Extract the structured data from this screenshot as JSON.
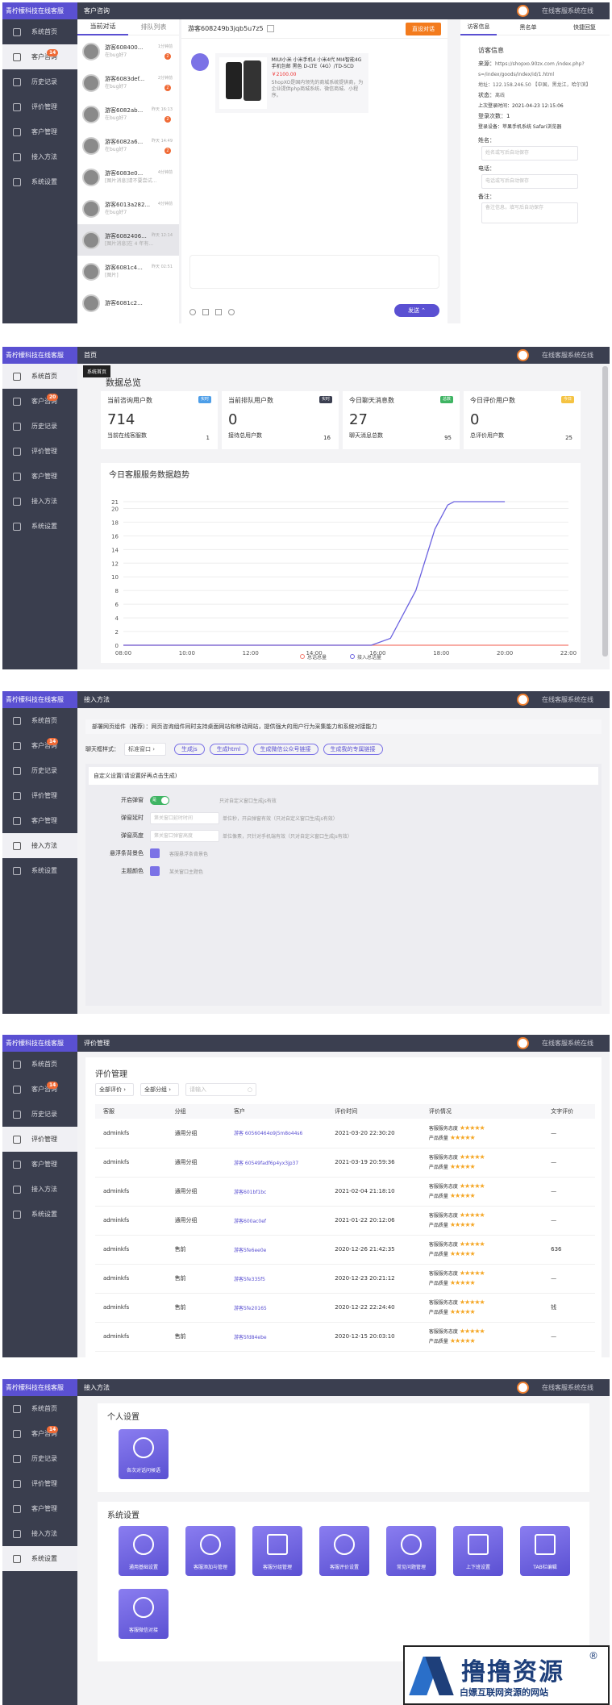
{
  "brand": "青柠檬科技在线客服",
  "online_text": "在线客服系统在线",
  "nav": [
    "系统首页",
    "客户咨询",
    "历史记录",
    "评价管理",
    "客户管理",
    "接入方法",
    "系统设置"
  ],
  "nav_badge": "14",
  "nav_badge_home": "20",
  "s1": {
    "topbar": "客户咨询",
    "tabs": [
      "当前对话",
      "排队列表"
    ],
    "visitors": [
      {
        "name": "游客608400...",
        "time": "1分钟前",
        "msg": "在bug好7",
        "badge": "2"
      },
      {
        "name": "游客6083def...",
        "time": "2分钟前",
        "msg": "在bug好7",
        "badge": "2"
      },
      {
        "name": "游客6082ab...",
        "time": "昨天 16:13",
        "msg": "在bug好7",
        "badge": "2"
      },
      {
        "name": "游客6082a6...",
        "time": "昨天 14:49",
        "msg": "在bug好7",
        "badge": "2"
      },
      {
        "name": "游客6083e0...",
        "time": "4分钟前",
        "msg": "[图片消息]请不要尝试...",
        "badge": ""
      },
      {
        "name": "游客6013a282...",
        "time": "4分钟前",
        "msg": "在bug好7",
        "badge": ""
      },
      {
        "name": "游客6082406...",
        "time": "昨天 12:14",
        "msg": "[图片消息]在 4 年有...",
        "badge": ""
      },
      {
        "name": "游客6081c4...",
        "time": "昨天 02:51",
        "msg": "[图片]",
        "badge": ""
      },
      {
        "name": "游客6081c2...",
        "time": "",
        "msg": "",
        "badge": ""
      }
    ],
    "chat_title": "游客608249b3jqb5u7z5",
    "end_btn": "直设对话",
    "product_title": "MIUI小米 小米手机4 小米4代 MI4智能4G手机包邮 黑色 D-LTE（4G）/TD-SCD",
    "product_price": "￥2100.00",
    "product_desc": "ShopXO是国内领先的商城系统提供商，为企业提供php商城系统、微信商城、小程序。",
    "send_btn": "发送",
    "right_tabs": [
      "访客信息",
      "黑名单",
      "快捷回复"
    ],
    "info_title": "访客信息",
    "source_label": "来源：",
    "source_url": "https://shopxo.90zx.com /index.php?s=/index/goods/index/id/1.html",
    "address": "地址：122.158.246.50 【中国，黑龙江，哈尔滨】",
    "status_label": "状态：",
    "status_value": "离线",
    "last_login": "上次登录时间：2021-04-23 12:15:06",
    "login_count": "登录次数：1",
    "device": "登录设备：苹果手机系统 Safari浏览器",
    "name_label": "姓名：",
    "name_ph": "姓名或写后自动保存",
    "phone_label": "电话：",
    "phone_ph": "电话或写后自动保存",
    "remark_label": "备注：",
    "remark_ph": "备注信息，填写后自动保存"
  },
  "s2": {
    "topbar": "首页",
    "tooltip": "系统首页",
    "heading": "数据总览",
    "stats": [
      {
        "title": "当前咨询用户数",
        "tag": "实时",
        "value": "714",
        "sub": "当前在线客服数",
        "subv": "1",
        "color": "#4d9ee8"
      },
      {
        "title": "当前排队用户数",
        "tag": "实时",
        "value": "0",
        "sub": "接待总用户数",
        "subv": "16",
        "color": "#3b3f50"
      },
      {
        "title": "今日聊天消息数",
        "tag": "总数",
        "value": "27",
        "sub": "聊天消息总数",
        "subv": "95",
        "color": "#3fb463"
      },
      {
        "title": "今日评价用户数",
        "tag": "今日",
        "value": "0",
        "sub": "总评价用户数",
        "subv": "25",
        "color": "#f5c342"
      }
    ],
    "chart_title": "今日客服服务数据趋势"
  },
  "chart_data": {
    "type": "line",
    "title": "今日客服服务数据趋势",
    "x": [
      "08:00",
      "10:00",
      "12:00",
      "14:00",
      "16:00",
      "18:00",
      "20:00",
      "22:00"
    ],
    "ylim": [
      0,
      21
    ],
    "yticks": [
      0,
      2,
      4,
      6,
      8,
      10,
      12,
      14,
      16,
      18,
      20,
      21
    ],
    "series": [
      {
        "name": "总话总量",
        "color": "#f37b6f",
        "points": [
          [
            0,
            0
          ],
          [
            4,
            0
          ],
          [
            5,
            0
          ],
          [
            7,
            0
          ]
        ]
      },
      {
        "name": "接入总话量",
        "color": "#6c63e0",
        "points": [
          [
            0,
            0
          ],
          [
            3.9,
            0
          ],
          [
            4.2,
            1
          ],
          [
            4.6,
            8
          ],
          [
            4.9,
            17
          ],
          [
            5.1,
            20.5
          ],
          [
            5.2,
            21
          ],
          [
            6,
            21
          ]
        ]
      }
    ]
  },
  "s3": {
    "topbar": "接入方法",
    "intro": "部署网页组件（推荐）：网页咨询组件同时支持桌面网站和移动网站，提供强大的用户行为采集能力和系统对接能力",
    "style_label": "聊天框样式：",
    "style_value": "标准窗口",
    "gen_btns": [
      "生成js",
      "生成html",
      "生成微信公众号链接",
      "生成我的专属链接"
    ],
    "custom_title": "自定义设置(请设置好再点击生成)",
    "rows": [
      {
        "label": "开启弹窗",
        "value": "是",
        "hint": "只对自定义窗口生成js有效"
      },
      {
        "label": "弹窗延时",
        "value": "第关窗口延时时间",
        "hint": "单位秒，开启弹窗有效（只对自定义窗口生成js有效）"
      },
      {
        "label": "弹窗高度",
        "value": "第关窗口弹窗高度",
        "hint": "单位像素，只针对手机端有效（只对自定义窗口生成js有效）"
      },
      {
        "label": "悬浮条背景色",
        "value": "",
        "hint": "客服悬浮条背景色"
      },
      {
        "label": "主题颜色",
        "value": "",
        "hint": "某关窗口主题色"
      }
    ]
  },
  "s4": {
    "topbar": "评价管理",
    "heading": "评价管理",
    "filter1": "全部评价",
    "filter2": "全部分组",
    "search_ph": "请输入",
    "cols": [
      "客服",
      "分组",
      "客户",
      "评价时间",
      "评价情况",
      "文字评价"
    ],
    "rate1": "客服服务态度",
    "rate2": "产品质量",
    "rows": [
      {
        "agent": "adminkfs",
        "group": "通用分组",
        "cust": "游客 60560464o9j5m8o44s6",
        "time": "2021-03-20 22:30:20",
        "text": "—"
      },
      {
        "agent": "adminkfs",
        "group": "通用分组",
        "cust": "游客 60549fadf6p4yx3jp37",
        "time": "2021-03-19 20:59:36",
        "text": "—"
      },
      {
        "agent": "adminkfs",
        "group": "通用分组",
        "cust": "游客601bf1bc",
        "time": "2021-02-04 21:18:10",
        "text": "—"
      },
      {
        "agent": "adminkfs",
        "group": "通用分组",
        "cust": "游客600ac0ef",
        "time": "2021-01-22 20:12:06",
        "text": "—"
      },
      {
        "agent": "adminkfs",
        "group": "售前",
        "cust": "游客5fe6ee0e",
        "time": "2020-12-26 21:42:35",
        "text": "636"
      },
      {
        "agent": "adminkfs",
        "group": "售前",
        "cust": "游客5fe335f5",
        "time": "2020-12-23 20:21:12",
        "text": "—"
      },
      {
        "agent": "adminkfs",
        "group": "售前",
        "cust": "游客5fe20165",
        "time": "2020-12-22 22:24:40",
        "text": "钱"
      },
      {
        "agent": "adminkfs",
        "group": "售前",
        "cust": "游客5fd84ebe",
        "time": "2020-12-15 20:03:10",
        "text": "—"
      }
    ]
  },
  "s5": {
    "topbar": "接入方法",
    "personal": "个人设置",
    "personal_tiles": [
      "各次对话问候语"
    ],
    "system": "系统设置",
    "system_tiles": [
      "通用基础设置",
      "客服添加与管理",
      "客服分组管理",
      "客服评价设置",
      "常见问题管理",
      "上下班设置",
      "TAB栏编辑",
      "客服微信对接"
    ]
  },
  "watermark": {
    "title": "撸撸资源",
    "sub": "白嫖互联网资源的网站",
    "reg": "®"
  }
}
